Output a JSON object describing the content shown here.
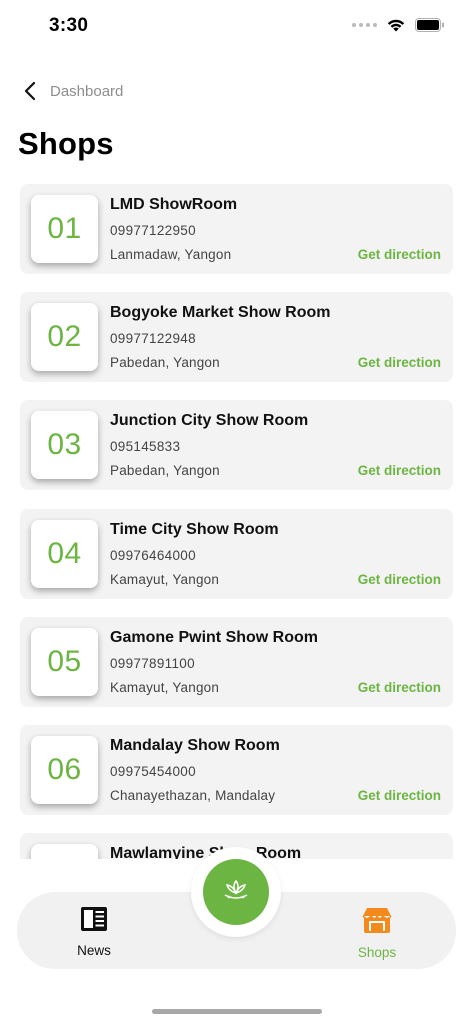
{
  "status_bar": {
    "time": "3:30",
    "icons": [
      "signal-icon",
      "wifi-icon",
      "battery-icon"
    ]
  },
  "navigation": {
    "back_label": "Dashboard",
    "back_icon": "chevron-left-icon"
  },
  "page": {
    "title": "Shops"
  },
  "shops": [
    {
      "number": "01",
      "name": "LMD ShowRoom",
      "phone": "09977122950",
      "address": "Lanmadaw, Yangon",
      "action": "Get direction"
    },
    {
      "number": "02",
      "name": "Bogyoke Market Show Room",
      "phone": "09977122948",
      "address": "Pabedan, Yangon",
      "action": "Get direction"
    },
    {
      "number": "03",
      "name": "Junction City Show Room",
      "phone": "095145833",
      "address": "Pabedan, Yangon",
      "action": "Get direction"
    },
    {
      "number": "04",
      "name": "Time City Show Room",
      "phone": "09976464000",
      "address": "Kamayut, Yangon",
      "action": "Get direction"
    },
    {
      "number": "05",
      "name": "Gamone Pwint Show Room",
      "phone": "09977891100",
      "address": "Kamayut, Yangon",
      "action": "Get direction"
    },
    {
      "number": "06",
      "name": "Mandalay Show Room",
      "phone": "09975454000",
      "address": "Chanayethazan, Mandalay",
      "action": "Get direction"
    },
    {
      "number": "",
      "name": "Mawlamyine Show Room",
      "phone": "",
      "address": "",
      "action": ""
    }
  ],
  "bottom_nav": {
    "items": [
      {
        "label": "News",
        "icon": "newspaper-icon",
        "active": false
      },
      {
        "label": "Shops",
        "icon": "storefront-icon",
        "active": true
      }
    ],
    "center_button_icon": "lotus-logo-icon"
  },
  "colors": {
    "accent": "#6db542",
    "shop_icon_orange": "#f28a1e",
    "card_background": "#f3f3f3",
    "nav_background": "#f1f1f1"
  }
}
